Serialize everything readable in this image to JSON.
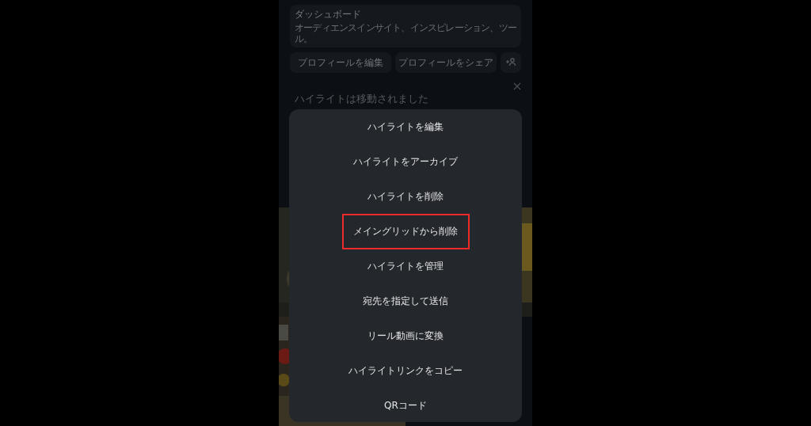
{
  "dashboard": {
    "title": "ダッシュボード",
    "subtitle": "オーディエンスインサイト、インスピレーション、ツール。"
  },
  "profile_buttons": [
    "プロフィールを編集",
    "プロフィールをシェア"
  ],
  "notice": {
    "title": "ハイライトは移動されました"
  },
  "menu": {
    "items": [
      {
        "label": "ハイライトを編集",
        "highlighted": false
      },
      {
        "label": "ハイライトをアーカイブ",
        "highlighted": false
      },
      {
        "label": "ハイライトを削除",
        "highlighted": false
      },
      {
        "label": "メイングリッドから削除",
        "highlighted": true
      },
      {
        "label": "ハイライトを管理",
        "highlighted": false
      },
      {
        "label": "宛先を指定して送信",
        "highlighted": false
      },
      {
        "label": "リール動画に変換",
        "highlighted": false
      },
      {
        "label": "ハイライトリンクをコピー",
        "highlighted": false
      },
      {
        "label": "QRコード",
        "highlighted": false
      }
    ]
  }
}
